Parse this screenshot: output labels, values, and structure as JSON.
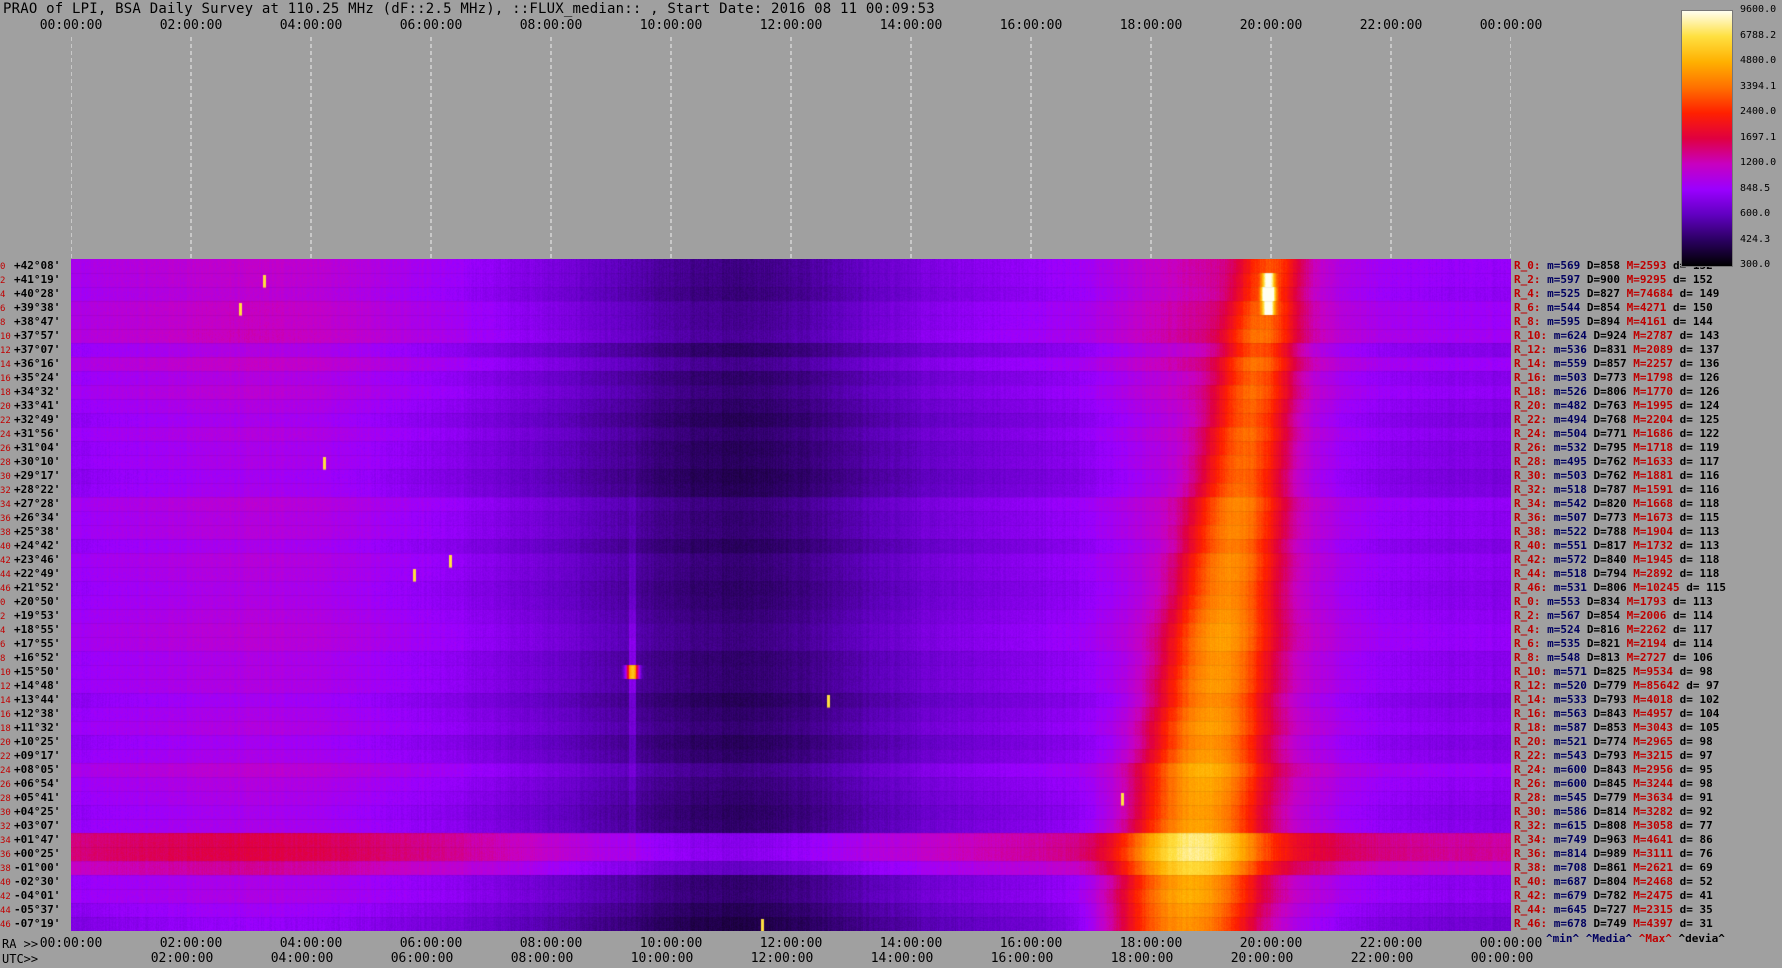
{
  "title": "PRAO of LPI, BSA Daily Survey at 110.25 MHz (dF::2.5 MHz), ::FLUX_median:: , Start Date: 2016 08 11 00:09:53",
  "bottom_left_label": "RA >>",
  "utc_label": "UTC>>",
  "time_ticks_top": [
    "00:00:00",
    "02:00:00",
    "04:00:00",
    "06:00:00",
    "08:00:00",
    "10:00:00",
    "12:00:00",
    "14:00:00",
    "16:00:00",
    "18:00:00",
    "20:00:00",
    "22:00:00",
    "00:00:00"
  ],
  "time_ticks_ra": [
    "00:00:00",
    "02:00:00",
    "04:00:00",
    "06:00:00",
    "08:00:00",
    "10:00:00",
    "12:00:00",
    "14:00:00",
    "16:00:00",
    "18:00:00",
    "20:00:00",
    "22:00:00",
    "00:00:00"
  ],
  "time_ticks_utc": [
    "02:00:00",
    "04:00:00",
    "06:00:00",
    "08:00:00",
    "10:00:00",
    "12:00:00",
    "14:00:00",
    "16:00:00",
    "18:00:00",
    "20:00:00",
    "22:00:00",
    "00:00:00"
  ],
  "colorbar": {
    "labels": [
      "9600.0",
      "6788.2",
      "4800.0",
      "3394.1",
      "2400.0",
      "1697.1",
      "1200.0",
      "848.5",
      "600.0",
      "424.3",
      "300.0"
    ],
    "colors": [
      "#000000",
      "#2a0060",
      "#6000c0",
      "#9a00ff",
      "#c800c0",
      "#e00040",
      "#ff2000",
      "#ff7000",
      "#ffb000",
      "#ffe040",
      "#fffff0"
    ]
  },
  "stat_header": {
    "min": "^min^",
    "media": "^Media^",
    "max": "^Max^",
    "devia": "^devia^"
  },
  "chart_data": {
    "type": "heatmap",
    "x_axis": "RA / UTC time",
    "xlim": [
      "00:00:00",
      "00:00:00"
    ],
    "colorbar_range": [
      300.0,
      9600.0
    ],
    "declinations": [
      "+42°08'",
      "+41°19'",
      "+40°28'",
      "+39°38'",
      "+38°47'",
      "+37°57'",
      "+37°07'",
      "+36°16'",
      "+35°24'",
      "+34°32'",
      "+33°41'",
      "+32°49'",
      "+31°56'",
      "+31°04'",
      "+30°10'",
      "+29°17'",
      "+28°22'",
      "+27°28'",
      "+26°34'",
      "+25°38'",
      "+24°42'",
      "+23°46'",
      "+22°49'",
      "+21°52'",
      "+20°50'",
      "+19°53'",
      "+18°55'",
      "+17°55'",
      "+16°52'",
      "+15°50'",
      "+14°48'",
      "+13°44'",
      "+12°38'",
      "+11°32'",
      "+10°25'",
      "+09°17'",
      "+08°05'",
      "+06°54'",
      "+05°41'",
      "+04°25'",
      "+03°07'",
      "+01°47'",
      "+00°25'",
      "-01°00'",
      "-02°30'",
      "-04°01'",
      "-05°37'",
      "-07°19'"
    ],
    "row_indices": [
      "0",
      "2",
      "4",
      "6",
      "8",
      "10",
      "12",
      "14",
      "16",
      "18",
      "20",
      "22",
      "24",
      "26",
      "28",
      "30",
      "32",
      "34",
      "36",
      "38",
      "40",
      "42",
      "44",
      "46",
      "0",
      "2",
      "4",
      "6",
      "8",
      "10",
      "12",
      "14",
      "16",
      "18",
      "20",
      "22",
      "24",
      "26",
      "28",
      "30",
      "32",
      "34",
      "36",
      "38",
      "40",
      "42",
      "44",
      "46"
    ],
    "row_stats": [
      {
        "r": "R_0:",
        "m": "m=569",
        "D": "D=858",
        "M": "M=2593",
        "d": "d= 152"
      },
      {
        "r": "R_2:",
        "m": "m=597",
        "D": "D=900",
        "M": "M=9295",
        "d": "d= 152"
      },
      {
        "r": "R_4:",
        "m": "m=525",
        "D": "D=827",
        "M": "M=74684",
        "d": "d= 149"
      },
      {
        "r": "R_6:",
        "m": "m=544",
        "D": "D=854",
        "M": "M=4271",
        "d": "d= 150"
      },
      {
        "r": "R_8:",
        "m": "m=595",
        "D": "D=894",
        "M": "M=4161",
        "d": "d= 144"
      },
      {
        "r": "R_10:",
        "m": "m=624",
        "D": "D=924",
        "M": "M=2787",
        "d": "d= 143"
      },
      {
        "r": "R_12:",
        "m": "m=536",
        "D": "D=831",
        "M": "M=2089",
        "d": "d= 137"
      },
      {
        "r": "R_14:",
        "m": "m=559",
        "D": "D=857",
        "M": "M=2257",
        "d": "d= 136"
      },
      {
        "r": "R_16:",
        "m": "m=503",
        "D": "D=773",
        "M": "M=1798",
        "d": "d= 126"
      },
      {
        "r": "R_18:",
        "m": "m=526",
        "D": "D=806",
        "M": "M=1770",
        "d": "d= 126"
      },
      {
        "r": "R_20:",
        "m": "m=482",
        "D": "D=763",
        "M": "M=1995",
        "d": "d= 124"
      },
      {
        "r": "R_22:",
        "m": "m=494",
        "D": "D=768",
        "M": "M=2204",
        "d": "d= 125"
      },
      {
        "r": "R_24:",
        "m": "m=504",
        "D": "D=771",
        "M": "M=1686",
        "d": "d= 122"
      },
      {
        "r": "R_26:",
        "m": "m=532",
        "D": "D=795",
        "M": "M=1718",
        "d": "d= 119"
      },
      {
        "r": "R_28:",
        "m": "m=495",
        "D": "D=762",
        "M": "M=1633",
        "d": "d= 117"
      },
      {
        "r": "R_30:",
        "m": "m=503",
        "D": "D=762",
        "M": "M=1881",
        "d": "d= 116"
      },
      {
        "r": "R_32:",
        "m": "m=518",
        "D": "D=787",
        "M": "M=1591",
        "d": "d= 116"
      },
      {
        "r": "R_34:",
        "m": "m=542",
        "D": "D=820",
        "M": "M=1668",
        "d": "d= 118"
      },
      {
        "r": "R_36:",
        "m": "m=507",
        "D": "D=773",
        "M": "M=1673",
        "d": "d= 115"
      },
      {
        "r": "R_38:",
        "m": "m=522",
        "D": "D=788",
        "M": "M=1904",
        "d": "d= 113"
      },
      {
        "r": "R_40:",
        "m": "m=551",
        "D": "D=817",
        "M": "M=1732",
        "d": "d= 113"
      },
      {
        "r": "R_42:",
        "m": "m=572",
        "D": "D=840",
        "M": "M=1945",
        "d": "d= 118"
      },
      {
        "r": "R_44:",
        "m": "m=518",
        "D": "D=794",
        "M": "M=2892",
        "d": "d= 118"
      },
      {
        "r": "R_46:",
        "m": "m=531",
        "D": "D=806",
        "M": "M=10245",
        "d": "d= 115"
      },
      {
        "r": "R_0:",
        "m": "m=553",
        "D": "D=834",
        "M": "M=1793",
        "d": "d= 113"
      },
      {
        "r": "R_2:",
        "m": "m=567",
        "D": "D=854",
        "M": "M=2006",
        "d": "d= 114"
      },
      {
        "r": "R_4:",
        "m": "m=524",
        "D": "D=816",
        "M": "M=2262",
        "d": "d= 117"
      },
      {
        "r": "R_6:",
        "m": "m=535",
        "D": "D=821",
        "M": "M=2194",
        "d": "d= 114"
      },
      {
        "r": "R_8:",
        "m": "m=548",
        "D": "D=813",
        "M": "M=2727",
        "d": "d= 106"
      },
      {
        "r": "R_10:",
        "m": "m=571",
        "D": "D=825",
        "M": "M=9534",
        "d": "d= 98"
      },
      {
        "r": "R_12:",
        "m": "m=520",
        "D": "D=779",
        "M": "M=85642",
        "d": "d= 97"
      },
      {
        "r": "R_14:",
        "m": "m=533",
        "D": "D=793",
        "M": "M=4018",
        "d": "d= 102"
      },
      {
        "r": "R_16:",
        "m": "m=563",
        "D": "D=843",
        "M": "M=4957",
        "d": "d= 104"
      },
      {
        "r": "R_18:",
        "m": "m=587",
        "D": "D=853",
        "M": "M=3043",
        "d": "d= 105"
      },
      {
        "r": "R_20:",
        "m": "m=521",
        "D": "D=774",
        "M": "M=2965",
        "d": "d= 98"
      },
      {
        "r": "R_22:",
        "m": "m=543",
        "D": "D=793",
        "M": "M=3215",
        "d": "d= 97"
      },
      {
        "r": "R_24:",
        "m": "m=600",
        "D": "D=843",
        "M": "M=2956",
        "d": "d= 95"
      },
      {
        "r": "R_26:",
        "m": "m=600",
        "D": "D=845",
        "M": "M=3244",
        "d": "d= 98"
      },
      {
        "r": "R_28:",
        "m": "m=545",
        "D": "D=779",
        "M": "M=3634",
        "d": "d= 91"
      },
      {
        "r": "R_30:",
        "m": "m=586",
        "D": "D=814",
        "M": "M=3282",
        "d": "d= 92"
      },
      {
        "r": "R_32:",
        "m": "m=615",
        "D": "D=808",
        "M": "M=3058",
        "d": "d= 77"
      },
      {
        "r": "R_34:",
        "m": "m=749",
        "D": "D=963",
        "M": "M=4641",
        "d": "d= 86"
      },
      {
        "r": "R_36:",
        "m": "m=814",
        "D": "D=989",
        "M": "M=3111",
        "d": "d= 76"
      },
      {
        "r": "R_38:",
        "m": "m=708",
        "D": "D=861",
        "M": "M=2621",
        "d": "d= 69"
      },
      {
        "r": "R_40:",
        "m": "m=687",
        "D": "D=804",
        "M": "M=2468",
        "d": "d= 52"
      },
      {
        "r": "R_42:",
        "m": "m=679",
        "D": "D=782",
        "M": "M=2475",
        "d": "d= 41"
      },
      {
        "r": "R_44:",
        "m": "m=645",
        "D": "D=727",
        "M": "M=2315",
        "d": "d= 35"
      },
      {
        "r": "R_46:",
        "m": "m=678",
        "D": "D=749",
        "M": "M=4397",
        "d": "d= 31"
      }
    ]
  }
}
